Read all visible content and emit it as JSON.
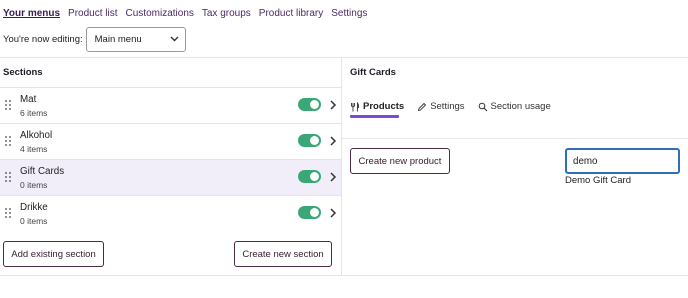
{
  "topnav": {
    "items": [
      "Your menus",
      "Product list",
      "Customizations",
      "Tax groups",
      "Product library",
      "Settings"
    ]
  },
  "editing": {
    "label": "You're now editing:",
    "selected_menu": "Main menu"
  },
  "sections_panel": {
    "title": "Sections",
    "items": [
      {
        "name": "Mat",
        "count": "6 items",
        "enabled": true
      },
      {
        "name": "Alkohol",
        "count": "4 items",
        "enabled": true
      },
      {
        "name": "Gift Cards",
        "count": "0 items",
        "enabled": true
      },
      {
        "name": "Drikke",
        "count": "0 items",
        "enabled": true
      }
    ],
    "add_existing_label": "Add existing section",
    "create_new_label": "Create new section"
  },
  "detail_panel": {
    "title": "Gift Cards",
    "tabs": [
      "Products",
      "Settings",
      "Section usage"
    ],
    "create_product_label": "Create new product",
    "search_value": "demo",
    "search_result": "Demo Gift Card"
  },
  "colors": {
    "accent": "#7b4ad6",
    "toggle_on": "#3aa876",
    "selected_row": "#f1eefa",
    "input_focus": "#2e6fb8"
  }
}
